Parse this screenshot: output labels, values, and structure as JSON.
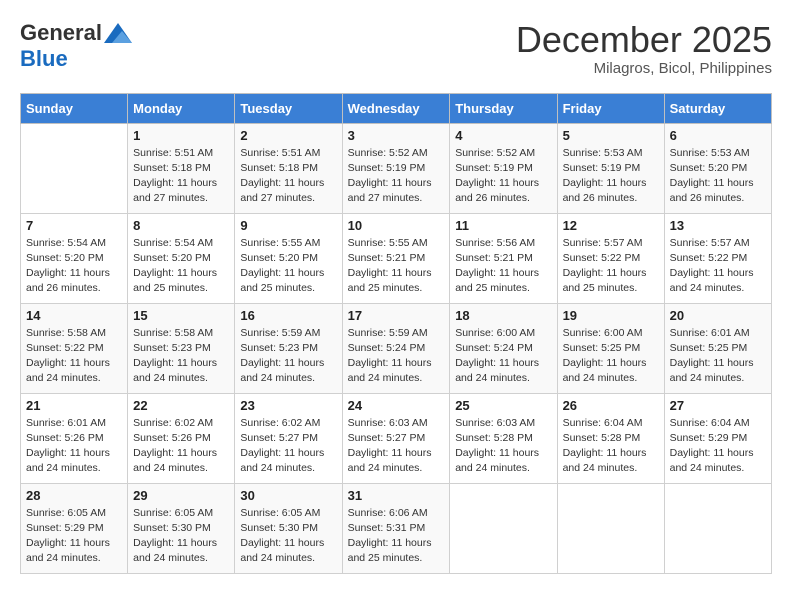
{
  "header": {
    "logo_general": "General",
    "logo_blue": "Blue",
    "month_title": "December 2025",
    "location": "Milagros, Bicol, Philippines"
  },
  "days_of_week": [
    "Sunday",
    "Monday",
    "Tuesday",
    "Wednesday",
    "Thursday",
    "Friday",
    "Saturday"
  ],
  "weeks": [
    [
      {
        "day": "",
        "info": ""
      },
      {
        "day": "1",
        "info": "Sunrise: 5:51 AM\nSunset: 5:18 PM\nDaylight: 11 hours\nand 27 minutes."
      },
      {
        "day": "2",
        "info": "Sunrise: 5:51 AM\nSunset: 5:18 PM\nDaylight: 11 hours\nand 27 minutes."
      },
      {
        "day": "3",
        "info": "Sunrise: 5:52 AM\nSunset: 5:19 PM\nDaylight: 11 hours\nand 27 minutes."
      },
      {
        "day": "4",
        "info": "Sunrise: 5:52 AM\nSunset: 5:19 PM\nDaylight: 11 hours\nand 26 minutes."
      },
      {
        "day": "5",
        "info": "Sunrise: 5:53 AM\nSunset: 5:19 PM\nDaylight: 11 hours\nand 26 minutes."
      },
      {
        "day": "6",
        "info": "Sunrise: 5:53 AM\nSunset: 5:20 PM\nDaylight: 11 hours\nand 26 minutes."
      }
    ],
    [
      {
        "day": "7",
        "info": "Sunrise: 5:54 AM\nSunset: 5:20 PM\nDaylight: 11 hours\nand 26 minutes."
      },
      {
        "day": "8",
        "info": "Sunrise: 5:54 AM\nSunset: 5:20 PM\nDaylight: 11 hours\nand 25 minutes."
      },
      {
        "day": "9",
        "info": "Sunrise: 5:55 AM\nSunset: 5:20 PM\nDaylight: 11 hours\nand 25 minutes."
      },
      {
        "day": "10",
        "info": "Sunrise: 5:55 AM\nSunset: 5:21 PM\nDaylight: 11 hours\nand 25 minutes."
      },
      {
        "day": "11",
        "info": "Sunrise: 5:56 AM\nSunset: 5:21 PM\nDaylight: 11 hours\nand 25 minutes."
      },
      {
        "day": "12",
        "info": "Sunrise: 5:57 AM\nSunset: 5:22 PM\nDaylight: 11 hours\nand 25 minutes."
      },
      {
        "day": "13",
        "info": "Sunrise: 5:57 AM\nSunset: 5:22 PM\nDaylight: 11 hours\nand 24 minutes."
      }
    ],
    [
      {
        "day": "14",
        "info": "Sunrise: 5:58 AM\nSunset: 5:22 PM\nDaylight: 11 hours\nand 24 minutes."
      },
      {
        "day": "15",
        "info": "Sunrise: 5:58 AM\nSunset: 5:23 PM\nDaylight: 11 hours\nand 24 minutes."
      },
      {
        "day": "16",
        "info": "Sunrise: 5:59 AM\nSunset: 5:23 PM\nDaylight: 11 hours\nand 24 minutes."
      },
      {
        "day": "17",
        "info": "Sunrise: 5:59 AM\nSunset: 5:24 PM\nDaylight: 11 hours\nand 24 minutes."
      },
      {
        "day": "18",
        "info": "Sunrise: 6:00 AM\nSunset: 5:24 PM\nDaylight: 11 hours\nand 24 minutes."
      },
      {
        "day": "19",
        "info": "Sunrise: 6:00 AM\nSunset: 5:25 PM\nDaylight: 11 hours\nand 24 minutes."
      },
      {
        "day": "20",
        "info": "Sunrise: 6:01 AM\nSunset: 5:25 PM\nDaylight: 11 hours\nand 24 minutes."
      }
    ],
    [
      {
        "day": "21",
        "info": "Sunrise: 6:01 AM\nSunset: 5:26 PM\nDaylight: 11 hours\nand 24 minutes."
      },
      {
        "day": "22",
        "info": "Sunrise: 6:02 AM\nSunset: 5:26 PM\nDaylight: 11 hours\nand 24 minutes."
      },
      {
        "day": "23",
        "info": "Sunrise: 6:02 AM\nSunset: 5:27 PM\nDaylight: 11 hours\nand 24 minutes."
      },
      {
        "day": "24",
        "info": "Sunrise: 6:03 AM\nSunset: 5:27 PM\nDaylight: 11 hours\nand 24 minutes."
      },
      {
        "day": "25",
        "info": "Sunrise: 6:03 AM\nSunset: 5:28 PM\nDaylight: 11 hours\nand 24 minutes."
      },
      {
        "day": "26",
        "info": "Sunrise: 6:04 AM\nSunset: 5:28 PM\nDaylight: 11 hours\nand 24 minutes."
      },
      {
        "day": "27",
        "info": "Sunrise: 6:04 AM\nSunset: 5:29 PM\nDaylight: 11 hours\nand 24 minutes."
      }
    ],
    [
      {
        "day": "28",
        "info": "Sunrise: 6:05 AM\nSunset: 5:29 PM\nDaylight: 11 hours\nand 24 minutes."
      },
      {
        "day": "29",
        "info": "Sunrise: 6:05 AM\nSunset: 5:30 PM\nDaylight: 11 hours\nand 24 minutes."
      },
      {
        "day": "30",
        "info": "Sunrise: 6:05 AM\nSunset: 5:30 PM\nDaylight: 11 hours\nand 24 minutes."
      },
      {
        "day": "31",
        "info": "Sunrise: 6:06 AM\nSunset: 5:31 PM\nDaylight: 11 hours\nand 25 minutes."
      },
      {
        "day": "",
        "info": ""
      },
      {
        "day": "",
        "info": ""
      },
      {
        "day": "",
        "info": ""
      }
    ]
  ]
}
